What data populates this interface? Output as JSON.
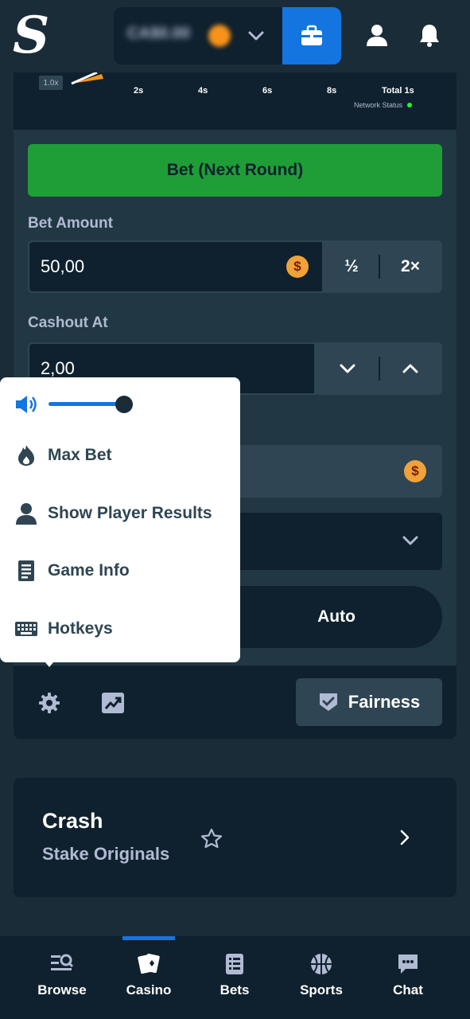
{
  "header": {
    "logo_text": "S",
    "balance": "CA$0.00",
    "icons": [
      "wallet-icon",
      "user-icon",
      "bell-icon"
    ]
  },
  "chart": {
    "multiplier_badge": "1.0x",
    "ticks": [
      "2s",
      "4s",
      "6s",
      "8s",
      "Total 1s"
    ],
    "network_status": "Network Status",
    "network_color": "#1fff20"
  },
  "controls": {
    "bet_button": "Bet (Next Round)",
    "bet_amount_label": "Bet Amount",
    "bet_amount_value": "50,00",
    "currency_symbol": "$",
    "half_label": "½",
    "double_label": "2×",
    "cashout_label": "Cashout At",
    "cashout_value": "2,00",
    "auto_tab": "Auto"
  },
  "popup": {
    "volume_level": 0.9,
    "items": [
      "Max Bet",
      "Show Player Results",
      "Game Info",
      "Hotkeys"
    ]
  },
  "game_footer": {
    "fairness_label": "Fairness"
  },
  "game_card": {
    "title": "Crash",
    "subtitle": "Stake Originals"
  },
  "nav": {
    "items": [
      "Browse",
      "Casino",
      "Bets",
      "Sports",
      "Chat"
    ],
    "active": "Casino"
  },
  "colors": {
    "bg": "#1a2c38",
    "panel": "#213743",
    "dark": "#0f212e",
    "accent_blue": "#1475e1",
    "bet_green": "#1f9e37",
    "coin": "#f0a23a"
  }
}
